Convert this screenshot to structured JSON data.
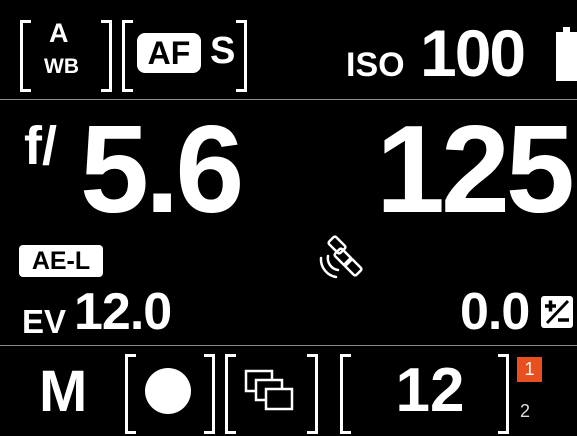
{
  "top_bar": {
    "wb": {
      "top": "A",
      "bottom": "WB"
    },
    "focus": {
      "af": "AF",
      "mode": "S"
    },
    "iso": {
      "label": "ISO",
      "value": "100"
    }
  },
  "exposure": {
    "aperture": {
      "prefix": "f/",
      "value": "5.6"
    },
    "shutter": {
      "value": "125"
    },
    "ae_lock": "AE-L",
    "ev": {
      "label": "EV",
      "value": "12.0"
    },
    "comp": {
      "value": "0.0",
      "icon_label": "+/-"
    }
  },
  "bottom_bar": {
    "mode": "M",
    "shots_remaining": "12",
    "card_slots": {
      "active": "1",
      "other": "2"
    }
  },
  "colors": {
    "background": "#000000",
    "text": "#ffffff",
    "accent": "#e8501f",
    "divider": "#8a8a8a"
  },
  "icons": {
    "battery": "battery-icon",
    "gps": "satellite-icon",
    "drive": "continuous-drive-icon",
    "record": "record-circle-icon",
    "exposure_comp": "plus-minus-icon"
  }
}
